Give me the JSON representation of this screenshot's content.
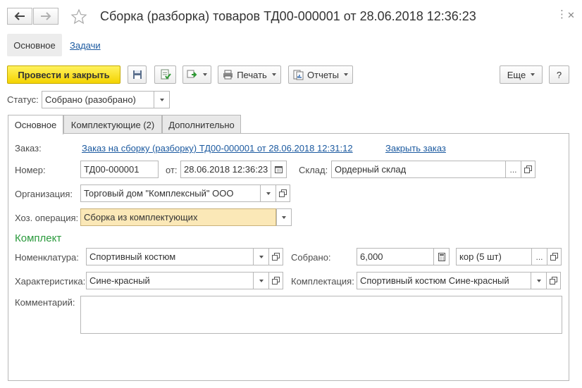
{
  "window": {
    "title": "Сборка (разборка) товаров ТД00-000001 от 28.06.2018 12:36:23",
    "menu_glyph": "⋮",
    "close_glyph": "✕"
  },
  "sections": {
    "main": "Основное",
    "tasks": "Задачи"
  },
  "toolbar": {
    "post_close": "Провести и закрыть",
    "print": "Печать",
    "reports": "Отчеты",
    "more": "Еще",
    "help": "?"
  },
  "status": {
    "label": "Статус:",
    "value": "Собрано (разобрано)"
  },
  "tabs": [
    {
      "label": "Основное",
      "active": true
    },
    {
      "label": "Комплектующие (2)",
      "active": false
    },
    {
      "label": "Дополнительно",
      "active": false
    }
  ],
  "form": {
    "order_label": "Заказ:",
    "order_link": "Заказ на сборку (разборку) ТД00-000001 от 28.06.2018 12:31:12",
    "close_order_link": "Закрыть заказ",
    "number_label": "Номер:",
    "number_value": "ТД00-000001",
    "date_label": "от:",
    "date_value": "28.06.2018 12:36:23",
    "warehouse_label": "Склад:",
    "warehouse_value": "Ордерный склад",
    "org_label": "Организация:",
    "org_value": "Торговый дом \"Комплексный\" ООО",
    "op_label": "Хоз. операция:",
    "op_value": "Сборка из комплектующих",
    "group_title": "Комплект",
    "nomen_label": "Номенклатура:",
    "nomen_value": "Спортивный костюм",
    "collected_label": "Собрано:",
    "collected_value": "6,000",
    "unit_value": "кор (5 шт)",
    "char_label": "Характеристика:",
    "char_value": "Сине-красный",
    "kit_label": "Комплектация:",
    "kit_value": "Спортивный костюм Сине-красный",
    "comment_label": "Комментарий:",
    "comment_value": "",
    "ellipsis": "..."
  },
  "colors": {
    "primary_button": "#f4d300",
    "link": "#1c5aa0",
    "group_title": "#2a9a3c",
    "highlight_field": "#fbe8b7"
  }
}
